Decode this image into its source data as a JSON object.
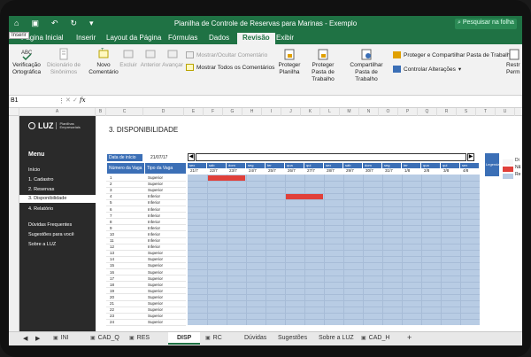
{
  "window": {
    "title": "Planilha de Controle de Reservas para Marinas - Exemplo",
    "search_placeholder": "Pesquisar na folha",
    "tooltip": "Inserir"
  },
  "ribbon_tabs": [
    {
      "label": "Página Inicial"
    },
    {
      "label": "Inserir"
    },
    {
      "label": "Layout da Página"
    },
    {
      "label": "Fórmulas"
    },
    {
      "label": "Dados"
    },
    {
      "label": "Revisão",
      "active": true
    },
    {
      "label": "Exibir"
    }
  ],
  "ribbon": {
    "spelling": "Verificação Ortográfica",
    "thesaurus": "Dicionário de Sinônimos",
    "new_comment": "Novo Comentário",
    "delete": "Excluir",
    "previous": "Anterior",
    "next": "Avançar",
    "show_hide_comment": "Mostrar/Ocultar Comentário",
    "show_all_comments": "Mostrar Todos os Comentários",
    "protect_sheet": "Proteger Planilha",
    "protect_workbook": "Proteger Pasta de Trabalho",
    "share_workbook": "Compartilhar Pasta de Trabalho",
    "protect_share": "Proteger e Compartilhar Pasta de Trabalho",
    "track_changes": "Controlar Alterações",
    "restrict": "Restr Perm"
  },
  "formula_bar": {
    "name_box": "B1",
    "fx": "fx"
  },
  "columns": [
    "A",
    "B",
    "C",
    "D",
    "E",
    "F",
    "G",
    "H",
    "I",
    "J",
    "K",
    "L",
    "M",
    "N",
    "O",
    "P",
    "Q",
    "R",
    "S",
    "T",
    "U"
  ],
  "menu": {
    "logo_text": "LUZ",
    "logo_sub": "Planilhas Empresariais",
    "title": "Menu",
    "items": [
      {
        "label": "Início"
      },
      {
        "label": "1. Cadastro"
      },
      {
        "label": "2. Reservas"
      },
      {
        "label": "3. Disponibilidade",
        "active": true
      },
      {
        "label": "4. Relatório"
      },
      {
        "label": "Dúvidas Frequentes"
      },
      {
        "label": "Sugestões para você"
      },
      {
        "label": "Sobre a LUZ"
      }
    ]
  },
  "section_title": "3. DISPONIBILIDADE",
  "start": {
    "label": "Data de início",
    "value": "21/07/17"
  },
  "table_headers": {
    "vaga": "Número da Vaga",
    "tipo": "Tipo da Vaga"
  },
  "days": [
    {
      "dow": "sex",
      "date": "21/7"
    },
    {
      "dow": "sáb",
      "date": "22/7"
    },
    {
      "dow": "dom",
      "date": "23/7"
    },
    {
      "dow": "seg",
      "date": "24/7"
    },
    {
      "dow": "ter",
      "date": "25/7"
    },
    {
      "dow": "qua",
      "date": "26/7"
    },
    {
      "dow": "qui",
      "date": "27/7"
    },
    {
      "dow": "sex",
      "date": "28/7"
    },
    {
      "dow": "sáb",
      "date": "29/7"
    },
    {
      "dow": "dom",
      "date": "30/7"
    },
    {
      "dow": "seg",
      "date": "31/7"
    },
    {
      "dow": "ter",
      "date": "1/8"
    },
    {
      "dow": "qua",
      "date": "2/8"
    },
    {
      "dow": "qui",
      "date": "3/8"
    },
    {
      "dow": "sex",
      "date": "4/8"
    }
  ],
  "vagas": [
    {
      "n": "1",
      "tipo": "Superior"
    },
    {
      "n": "2",
      "tipo": "Superior"
    },
    {
      "n": "3",
      "tipo": "Superior"
    },
    {
      "n": "4",
      "tipo": "Inferior"
    },
    {
      "n": "5",
      "tipo": "Inferior"
    },
    {
      "n": "6",
      "tipo": "Inferior"
    },
    {
      "n": "7",
      "tipo": "Inferior"
    },
    {
      "n": "8",
      "tipo": "Inferior"
    },
    {
      "n": "9",
      "tipo": "Inferior"
    },
    {
      "n": "10",
      "tipo": "Inferior"
    },
    {
      "n": "11",
      "tipo": "Inferior"
    },
    {
      "n": "12",
      "tipo": "Inferior"
    },
    {
      "n": "13",
      "tipo": "Superior"
    },
    {
      "n": "14",
      "tipo": "Superior"
    },
    {
      "n": "15",
      "tipo": "Superior"
    },
    {
      "n": "16",
      "tipo": "Superior"
    },
    {
      "n": "17",
      "tipo": "Superior"
    },
    {
      "n": "18",
      "tipo": "Superior"
    },
    {
      "n": "19",
      "tipo": "Superior"
    },
    {
      "n": "20",
      "tipo": "Superior"
    },
    {
      "n": "21",
      "tipo": "Superior"
    },
    {
      "n": "22",
      "tipo": "Superior"
    },
    {
      "n": "23",
      "tipo": "Superior"
    },
    {
      "n": "24",
      "tipo": "Superior"
    }
  ],
  "reservations": [
    {
      "vaga": "1",
      "start": "22/7",
      "end": "23/7"
    },
    {
      "vaga": "4",
      "start": "26/7",
      "end": "27/7"
    }
  ],
  "legend": {
    "title": "Legenda",
    "items": [
      "Di",
      "Nã",
      "Re"
    ],
    "colors": [
      "#f5f5f5",
      "#e0403a",
      "#b8cce4"
    ]
  },
  "sheet_tabs": [
    {
      "label": "INI",
      "icon": "lock-icon"
    },
    {
      "label": "CAD_Q",
      "icon": "lock-icon"
    },
    {
      "label": "RES",
      "icon": "lock-icon"
    },
    {
      "label": "DISP",
      "active": true
    },
    {
      "label": "RC",
      "icon": "lock-icon"
    },
    {
      "label": "Dúvidas"
    },
    {
      "label": "Sugestões"
    },
    {
      "label": "Sobre a LUZ"
    },
    {
      "label": "CAD_H",
      "icon": "lock-icon"
    }
  ],
  "colors": {
    "excel_green": "#1f7244",
    "header_blue": "#3b6fb6",
    "cell_blue": "#b8cce4",
    "reserved_red": "#e0403a",
    "menu_dark": "#2a2a2a"
  }
}
